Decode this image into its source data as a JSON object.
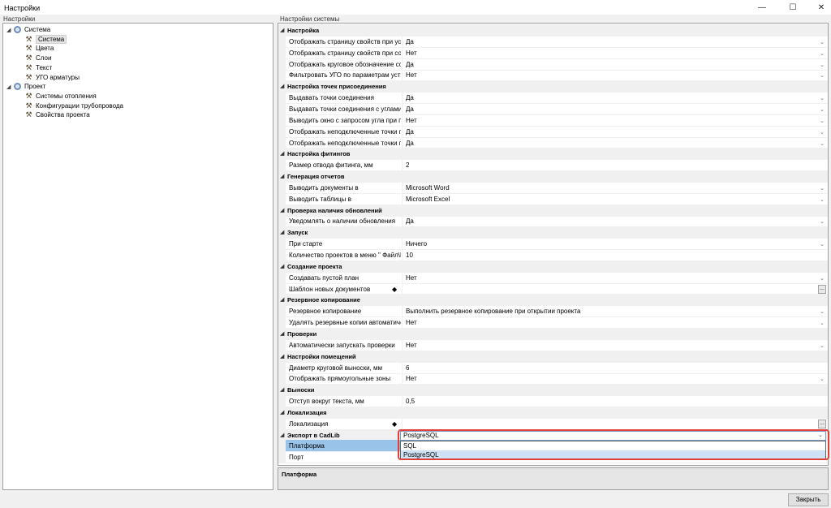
{
  "window": {
    "title": "Настройки",
    "minimize_icon": "minimize-icon",
    "maximize_icon": "maximize-icon",
    "close_icon": "close-icon"
  },
  "left_pane": {
    "label": "Настройки"
  },
  "tree": [
    {
      "label": "Система",
      "icon": "gear-icon",
      "expander": "◢",
      "level": 0
    },
    {
      "label": "Система",
      "icon": "tools-icon",
      "level": 1,
      "selected": true
    },
    {
      "label": "Цвета",
      "icon": "tools-icon",
      "level": 1
    },
    {
      "label": "Слои",
      "icon": "tools-icon",
      "level": 1
    },
    {
      "label": "Текст",
      "icon": "tools-icon",
      "level": 1
    },
    {
      "label": "УГО арматуры",
      "icon": "tools-icon",
      "level": 1
    },
    {
      "label": "Проект",
      "icon": "gear-icon",
      "expander": "◢",
      "level": 0
    },
    {
      "label": "Системы отопления",
      "icon": "tools-icon",
      "level": 1
    },
    {
      "label": "Конфигурации трубопровода",
      "icon": "tools-icon",
      "level": 1
    },
    {
      "label": "Свойства проекта",
      "icon": "tools-icon",
      "level": 1
    }
  ],
  "right_pane": {
    "label": "Настройки системы"
  },
  "grid_rows": [
    {
      "type": "cat",
      "label": "Настройка"
    },
    {
      "type": "prop",
      "name": "Отображать страницу свойств при уста...",
      "value": "Да",
      "dropdown": true
    },
    {
      "type": "prop",
      "name": "Отображать страницу свойств при созд...",
      "value": "Нет",
      "dropdown": true
    },
    {
      "type": "prop",
      "name": "Отображать круговое обозначение соз...",
      "value": "Да",
      "dropdown": true
    },
    {
      "type": "prop",
      "name": "Фильтровать УГО по параметрам устр...",
      "value": "Нет",
      "dropdown": true
    },
    {
      "type": "cat",
      "label": "Настройка точек присоединения"
    },
    {
      "type": "prop",
      "name": "Выдавать точки соединения",
      "value": "Да",
      "dropdown": true
    },
    {
      "type": "prop",
      "name": "Выдавать точки соединения с углами (...",
      "value": "Да",
      "dropdown": true
    },
    {
      "type": "prop",
      "name": "Выводить окно с запросом угла при по...",
      "value": "Нет",
      "dropdown": true
    },
    {
      "type": "prop",
      "name": "Отображать неподключенные точки пр...",
      "value": "Да",
      "dropdown": true
    },
    {
      "type": "prop",
      "name": "Отображать неподключенные точки пр...",
      "value": "Да",
      "dropdown": true
    },
    {
      "type": "cat",
      "label": "Настройка фитингов"
    },
    {
      "type": "prop",
      "name": "Размер отвода фитинга, мм",
      "value": "2"
    },
    {
      "type": "cat",
      "label": "Генерация отчетов"
    },
    {
      "type": "prop",
      "name": "Выводить документы в",
      "value": "Microsoft Word",
      "dropdown": true
    },
    {
      "type": "prop",
      "name": "Выводить таблицы в",
      "value": "Microsoft Excel",
      "dropdown": true
    },
    {
      "type": "cat",
      "label": "Проверка наличия обновлений"
    },
    {
      "type": "prop",
      "name": "Уведомлять о наличии обновления",
      "value": "Да",
      "dropdown": true
    },
    {
      "type": "cat",
      "label": "Запуск"
    },
    {
      "type": "prop",
      "name": "При старте",
      "value": "Ничего",
      "dropdown": true
    },
    {
      "type": "prop",
      "name": "Количество проектов в меню \" Файл\\П...",
      "value": "10"
    },
    {
      "type": "cat",
      "label": "Создание проекта"
    },
    {
      "type": "prop",
      "name": "Создавать пустой план",
      "value": "Нет",
      "dropdown": true
    },
    {
      "type": "prop",
      "name": "Шаблон новых документов",
      "value": "",
      "diamond": true,
      "ellipsis": true
    },
    {
      "type": "cat",
      "label": "Резервное копирование"
    },
    {
      "type": "prop",
      "name": "Резервное копирование",
      "value": "Выполнить резервное копирование при открытии проекта",
      "dropdown": true
    },
    {
      "type": "prop",
      "name": "Удалять резервные копии автоматичес...",
      "value": "Нет",
      "dropdown": true
    },
    {
      "type": "cat",
      "label": "Проверки"
    },
    {
      "type": "prop",
      "name": "Автоматически запускать проверки",
      "value": "Нет",
      "dropdown": true
    },
    {
      "type": "cat",
      "label": "Настройки помещений"
    },
    {
      "type": "prop",
      "name": "Диаметр круговой выноски, мм",
      "value": "6"
    },
    {
      "type": "prop",
      "name": "Отображать прямоугольные зоны",
      "value": "Нет",
      "dropdown": true
    },
    {
      "type": "cat",
      "label": "Выноски"
    },
    {
      "type": "prop",
      "name": "Отступ вокруг текста, мм",
      "value": "0,5"
    },
    {
      "type": "cat",
      "label": "Локализация"
    },
    {
      "type": "prop",
      "name": "Локализация",
      "value": "",
      "diamond": true,
      "ellipsis": true
    },
    {
      "type": "cat",
      "label": "Экспорт в CadLib"
    },
    {
      "type": "prop",
      "name": "Платформа",
      "value": "",
      "selected": true
    },
    {
      "type": "prop",
      "name": "Порт",
      "value": ""
    }
  ],
  "dropdown": {
    "selected": "PostgreSQL",
    "options": [
      "SQL",
      "PostgreSQL"
    ],
    "active_index": 1
  },
  "description": {
    "title": "Платформа"
  },
  "buttons": {
    "close_label": "Закрыть"
  },
  "colors": {
    "selection": "#99c3e8",
    "highlight_border": "#e0403a",
    "dropdown_active": "#cfe2f5"
  }
}
